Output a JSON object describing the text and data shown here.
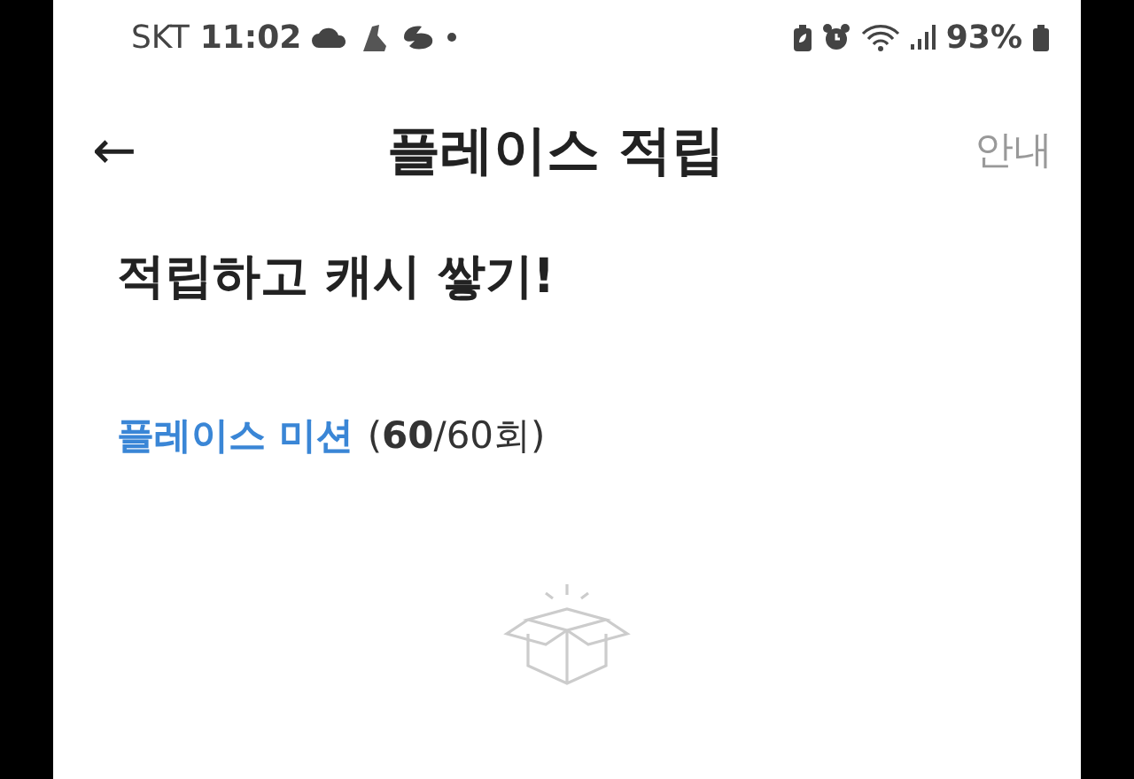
{
  "status_bar": {
    "carrier": "SKT",
    "time": "11:02",
    "battery": "93%"
  },
  "header": {
    "back": "←",
    "title": "플레이스 적립",
    "action": "안내"
  },
  "heading": "적립하고 캐시 쌓기!",
  "mission": {
    "label": "플레이스 미션",
    "count": "(**60**/60회)"
  }
}
